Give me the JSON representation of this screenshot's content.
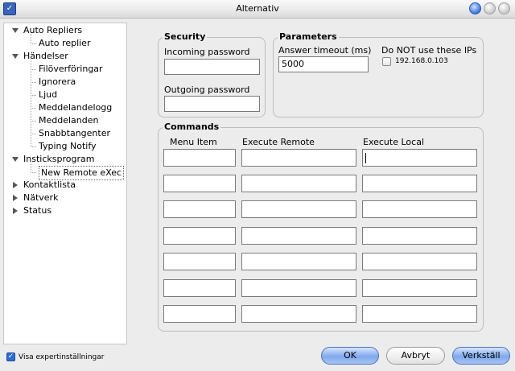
{
  "window": {
    "title": "Alternativ",
    "app_icon": "checklist-icon"
  },
  "tree": {
    "items": [
      {
        "label": "Auto Repliers",
        "level": 0,
        "expander": "expanded"
      },
      {
        "label": "Auto replier",
        "level": 1
      },
      {
        "label": "Händelser",
        "level": 0,
        "expander": "expanded"
      },
      {
        "label": "Filöverföringar",
        "level": 1
      },
      {
        "label": "Ignorera",
        "level": 1
      },
      {
        "label": "Ljud",
        "level": 1
      },
      {
        "label": "Meddelandelogg",
        "level": 1
      },
      {
        "label": "Meddelanden",
        "level": 1
      },
      {
        "label": "Snabbtangenter",
        "level": 1
      },
      {
        "label": "Typing Notify",
        "level": 1
      },
      {
        "label": "Insticksprogram",
        "level": 0,
        "expander": "expanded"
      },
      {
        "label": "New Remote eXec",
        "level": 1,
        "selected": true
      },
      {
        "label": "Kontaktlista",
        "level": 0,
        "expander": "collapsed"
      },
      {
        "label": "Nätverk",
        "level": 0,
        "expander": "collapsed"
      },
      {
        "label": "Status",
        "level": 0,
        "expander": "collapsed"
      }
    ]
  },
  "security": {
    "title": "Security",
    "incoming_label": "Incoming password",
    "incoming_value": "",
    "outgoing_label": "Outgoing password",
    "outgoing_value": ""
  },
  "parameters": {
    "title": "Parameters",
    "timeout_label": "Answer timeout (ms)",
    "timeout_value": "5000",
    "ignore_ips_label": "Do NOT use these IPs",
    "ips": [
      {
        "label": "192.168.0.103",
        "checked": false
      }
    ]
  },
  "commands": {
    "title": "Commands",
    "headers": [
      "Menu Item",
      "Execute Remote",
      "Execute Local"
    ],
    "rows": [
      [
        "",
        "",
        ""
      ],
      [
        "",
        "",
        ""
      ],
      [
        "",
        "",
        ""
      ],
      [
        "",
        "",
        ""
      ],
      [
        "",
        "",
        ""
      ],
      [
        "",
        "",
        ""
      ],
      [
        "",
        "",
        ""
      ]
    ]
  },
  "footer": {
    "expert_label": "Visa expertinställningar",
    "expert_checked": true,
    "ok_label": "OK",
    "cancel_label": "Avbryt",
    "apply_label": "Verkställ"
  }
}
